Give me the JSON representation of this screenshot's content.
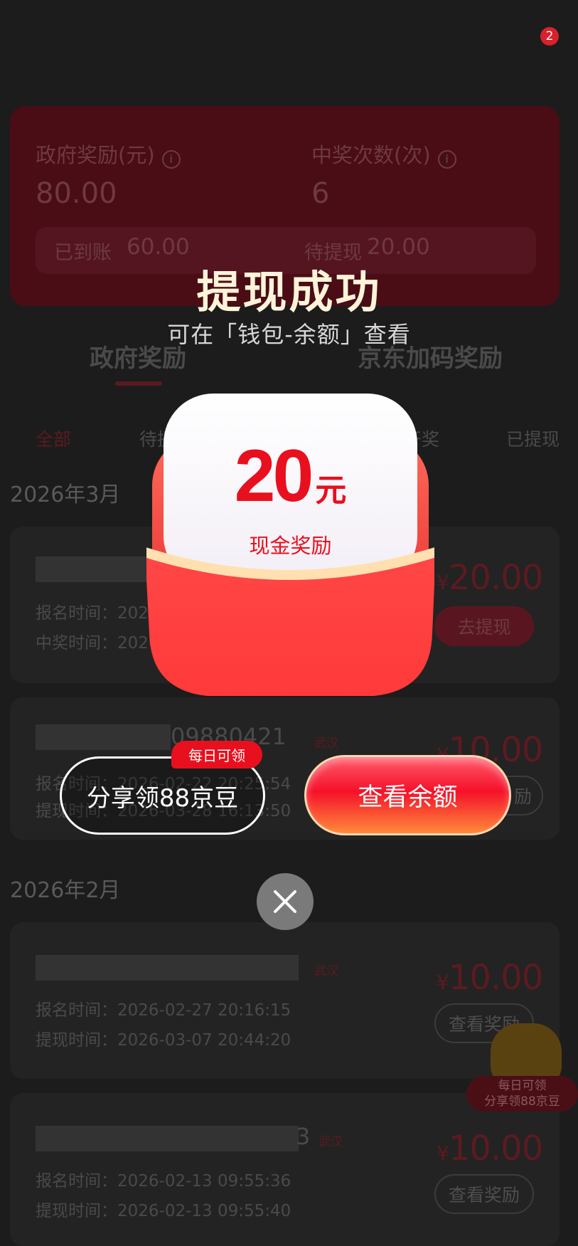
{
  "header": {
    "badge_count": "2"
  },
  "summary": {
    "gov_label": "政府奖励(元)",
    "gov_value": "80.00",
    "count_label": "中奖次数(次)",
    "count_value": "6",
    "received_label": "已到账",
    "received_value": "60.00",
    "pending_label": "待提现",
    "pending_value": "20.00"
  },
  "tabs": [
    "政府奖励",
    "京东加码奖励"
  ],
  "filters": [
    "全部",
    "待提",
    "开奖",
    "已提现"
  ],
  "months": [
    "2026年3月",
    "2026年2月"
  ],
  "records": [
    {
      "id_tail": "",
      "city": "",
      "line1_label": "报名时间：",
      "line1_value": "202",
      "line2_label": "中奖时间：",
      "line2_value": "2026",
      "currency": "¥",
      "amount": "20.00",
      "action": "去提现"
    },
    {
      "id_tail": "09880421",
      "city": "武汉",
      "line1_label": "报名时间：",
      "line1_value": "2026-02-22 20:25:54",
      "line2_label": "提现时间：",
      "line2_value": "2026-03-28 16:13:50",
      "currency": "¥",
      "amount": "10.00",
      "action": "励"
    },
    {
      "id_tail": "",
      "city": "武汉",
      "line1_label": "报名时间：",
      "line1_value": "2026-02-27 20:16:15",
      "line2_label": "提现时间：",
      "line2_value": "2026-03-07 20:44:20",
      "currency": "¥",
      "amount": "10.00",
      "action": "查看奖励"
    },
    {
      "id_tail": "3",
      "city": "武汉",
      "line1_label": "报名时间：",
      "line1_value": "2026-02-13 09:55:36",
      "line2_label": "提现时间：",
      "line2_value": "2026-02-13 09:55:40",
      "currency": "¥",
      "amount": "10.00",
      "action": "查看奖励"
    }
  ],
  "float_promo": {
    "line1": "每日可领",
    "line2": "分享领88京豆"
  },
  "modal": {
    "title": "提现成功",
    "subtitle": "可在「钱包-余额」查看",
    "amount": "20",
    "unit": "元",
    "reward_label": "现金奖励",
    "share_tag": "每日可领",
    "share_button": "分享领88京豆",
    "balance_button": "查看余额"
  },
  "colors": {
    "accent": "#e8101e",
    "title": "#fff4da"
  }
}
